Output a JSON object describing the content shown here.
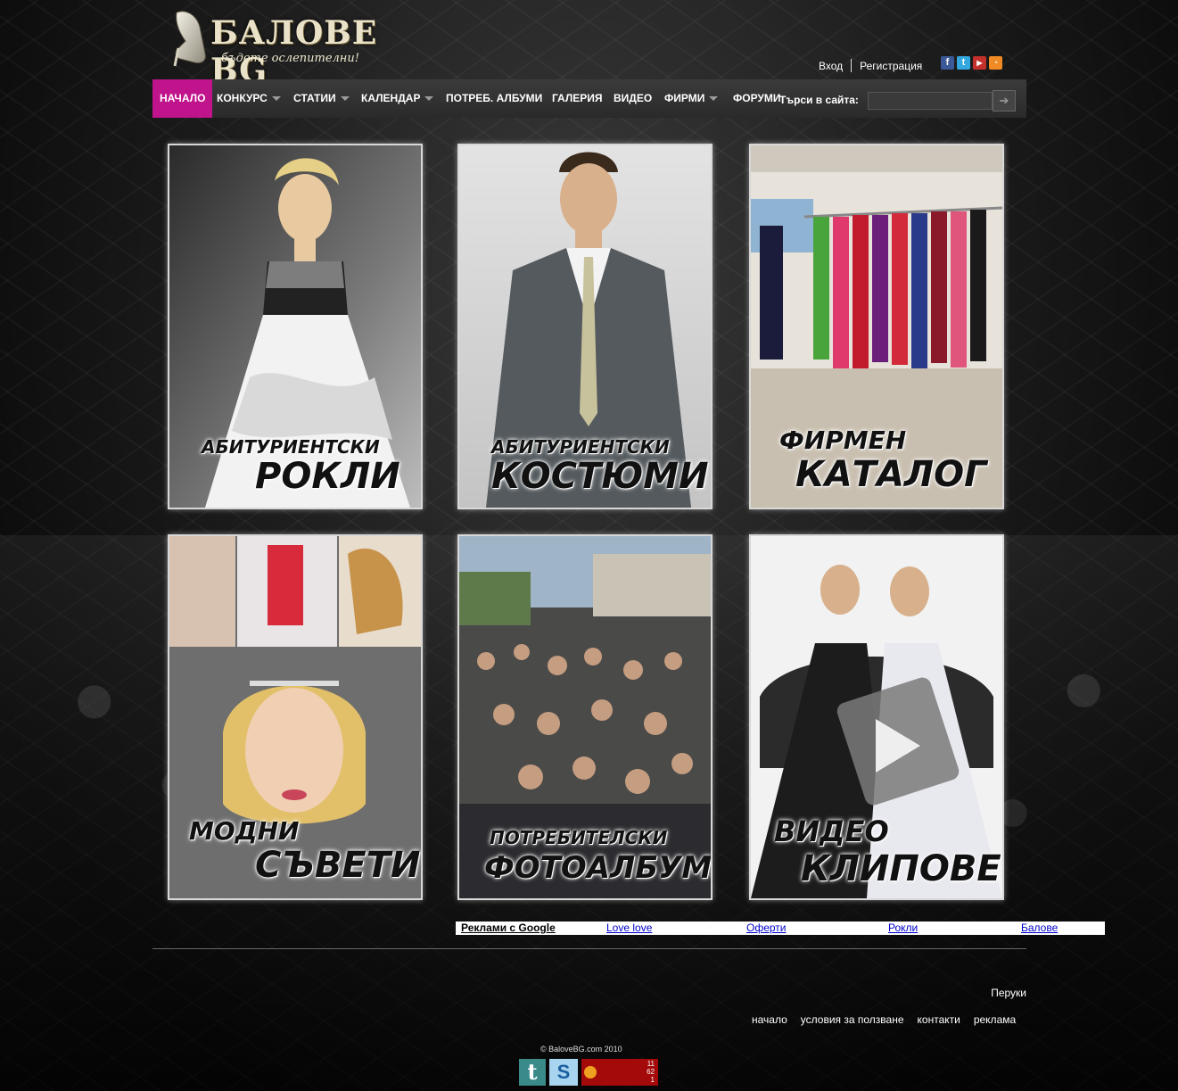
{
  "logo": {
    "title": "БАЛОВЕ BG",
    "slogan": "бъдете ослепителни!"
  },
  "top_links": {
    "login": "Вход",
    "register": "Регистрация"
  },
  "social": [
    "facebook-icon",
    "twitter-icon",
    "youtube-icon",
    "rss-icon"
  ],
  "nav": {
    "items": [
      {
        "label": "НАЧАЛО",
        "active": true,
        "dropdown": false
      },
      {
        "label": "КОНКУРС",
        "dropdown": true
      },
      {
        "label": "СТАТИИ",
        "dropdown": true
      },
      {
        "label": "КАЛЕНДАР",
        "dropdown": true
      },
      {
        "label": "ПОТРЕБ. АЛБУМИ",
        "dropdown": false
      },
      {
        "label": "ГАЛЕРИЯ",
        "dropdown": false
      },
      {
        "label": "ВИДЕО",
        "dropdown": false
      },
      {
        "label": "ФИРМИ",
        "dropdown": true
      },
      {
        "label": "ФОРУМИ",
        "dropdown": false
      }
    ],
    "search_label": "Търси в сайта:",
    "search_value": "",
    "accent": "#c0148c"
  },
  "tiles": [
    {
      "line1": "АБИТУРИЕНТСКИ",
      "line2": "РОКЛИ"
    },
    {
      "line1": "АБИТУРИЕНТСКИ",
      "line2": "КОСТЮМИ"
    },
    {
      "line1": "ФИРМЕН",
      "line2": "КАТАЛОГ"
    },
    {
      "line1": "МОДНИ",
      "line2": "СЪВЕТИ"
    },
    {
      "line1": "ПОТРЕБИТЕЛСКИ",
      "line2": "ФОТОАЛБУМИ"
    },
    {
      "line1": "ВИДЕО",
      "line2": "КЛИПОВЕ"
    }
  ],
  "ads": {
    "title": "Реклами с Google",
    "links": [
      "Love love",
      "Оферти",
      "Рокли",
      "Балове"
    ]
  },
  "footer": {
    "right_text": "Перуки",
    "links": [
      "начало",
      "условия за ползване",
      "контакти",
      "реклама"
    ],
    "copyright": "© BaloveBG.com 2010",
    "counter": {
      "top": "11",
      "mid": "62",
      "bottom": "1"
    }
  }
}
